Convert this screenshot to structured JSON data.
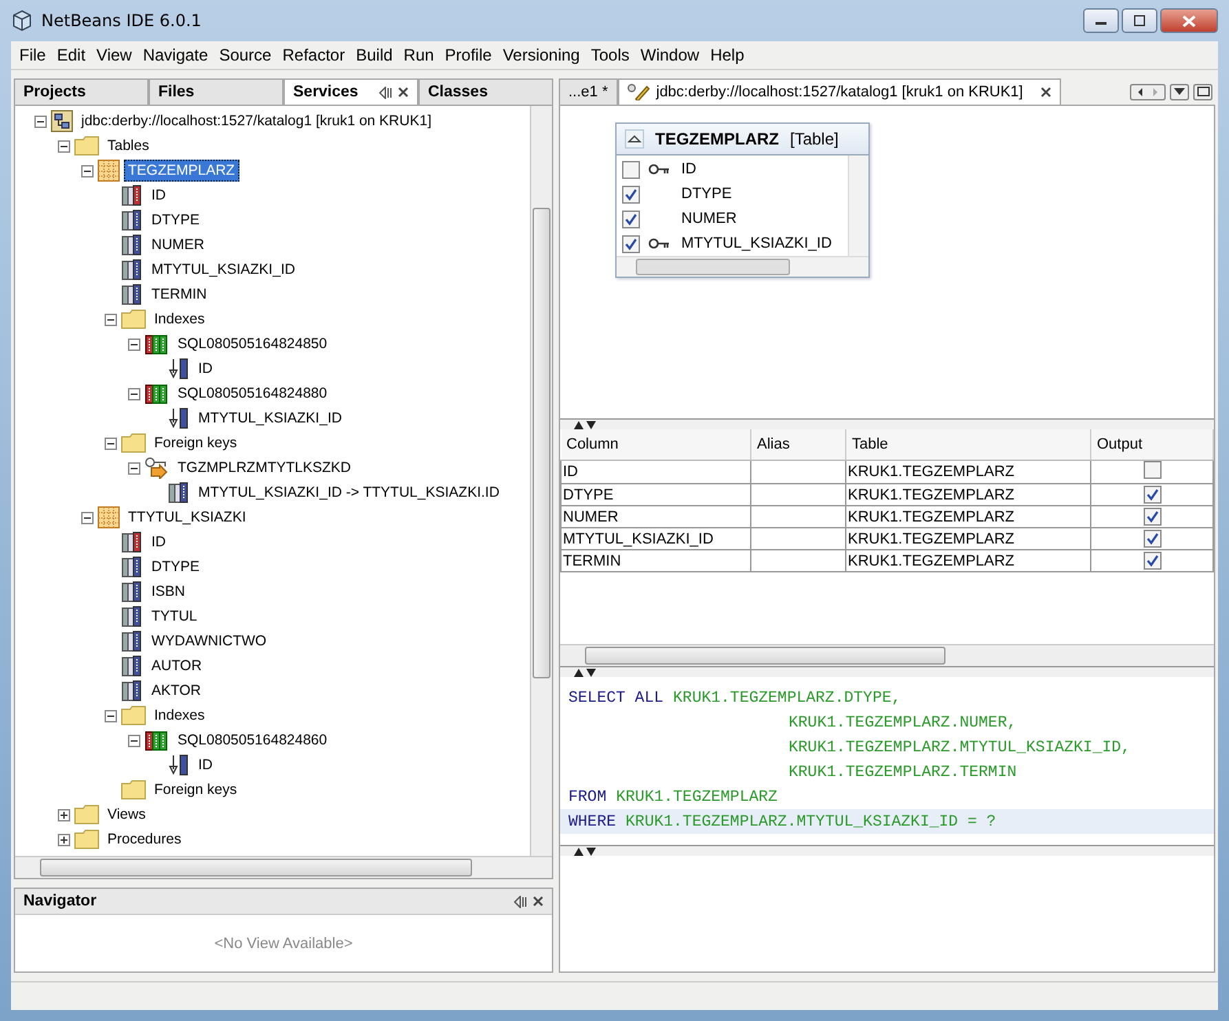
{
  "window": {
    "title": "NetBeans IDE 6.0.1"
  },
  "menu": [
    "File",
    "Edit",
    "View",
    "Navigate",
    "Source",
    "Refactor",
    "Build",
    "Run",
    "Profile",
    "Versioning",
    "Tools",
    "Window",
    "Help"
  ],
  "left_tabs": [
    {
      "label": "Projects",
      "selected": false
    },
    {
      "label": "Files",
      "selected": false
    },
    {
      "label": "Services",
      "selected": true
    },
    {
      "label": "Classes",
      "selected": false
    }
  ],
  "tree": {
    "items": [
      {
        "kind": "connection",
        "label": "jdbc:derby://localhost:1527/katalog1 [kruk1 on KRUK1]",
        "expanded": true,
        "selected": false,
        "children": [
          {
            "kind": "folder",
            "label": "Tables",
            "expanded": true,
            "selected": false,
            "children": [
              {
                "kind": "table",
                "label": "TEGZEMPLARZ",
                "expanded": true,
                "selected": true,
                "children": [
                  {
                    "kind": "pk_column",
                    "label": "ID",
                    "selected": false
                  },
                  {
                    "kind": "column",
                    "label": "DTYPE",
                    "selected": false
                  },
                  {
                    "kind": "column",
                    "label": "NUMER",
                    "selected": false
                  },
                  {
                    "kind": "column",
                    "label": "MTYTUL_KSIAZKI_ID",
                    "selected": false
                  },
                  {
                    "kind": "column",
                    "label": "TERMIN",
                    "selected": false
                  },
                  {
                    "kind": "folder",
                    "label": "Indexes",
                    "expanded": true,
                    "selected": false,
                    "children": [
                      {
                        "kind": "index",
                        "label": "SQL080505164824850",
                        "expanded": true,
                        "selected": false,
                        "children": [
                          {
                            "kind": "index_column",
                            "label": "ID",
                            "selected": false
                          }
                        ]
                      },
                      {
                        "kind": "index",
                        "label": "SQL080505164824880",
                        "expanded": true,
                        "selected": false,
                        "children": [
                          {
                            "kind": "index_column",
                            "label": "MTYTUL_KSIAZKI_ID",
                            "selected": false
                          }
                        ]
                      }
                    ]
                  },
                  {
                    "kind": "folder",
                    "label": "Foreign keys",
                    "expanded": true,
                    "selected": false,
                    "children": [
                      {
                        "kind": "foreign_key",
                        "label": "TGZMPLRZMTYTLKSZKD",
                        "expanded": true,
                        "selected": false,
                        "children": [
                          {
                            "kind": "fk_column",
                            "label": "MTYTUL_KSIAZKI_ID -> TTYTUL_KSIAZKI.ID",
                            "selected": false
                          }
                        ]
                      }
                    ]
                  }
                ]
              },
              {
                "kind": "table",
                "label": "TTYTUL_KSIAZKI",
                "expanded": true,
                "selected": false,
                "children": [
                  {
                    "kind": "pk_column",
                    "label": "ID",
                    "selected": false
                  },
                  {
                    "kind": "column",
                    "label": "DTYPE",
                    "selected": false
                  },
                  {
                    "kind": "column",
                    "label": "ISBN",
                    "selected": false
                  },
                  {
                    "kind": "column",
                    "label": "TYTUL",
                    "selected": false
                  },
                  {
                    "kind": "column",
                    "label": "WYDAWNICTWO",
                    "selected": false
                  },
                  {
                    "kind": "column",
                    "label": "AUTOR",
                    "selected": false
                  },
                  {
                    "kind": "column",
                    "label": "AKTOR",
                    "selected": false
                  },
                  {
                    "kind": "folder",
                    "label": "Indexes",
                    "expanded": true,
                    "selected": false,
                    "children": [
                      {
                        "kind": "index",
                        "label": "SQL080505164824860",
                        "expanded": true,
                        "selected": false,
                        "children": [
                          {
                            "kind": "index_column",
                            "label": "ID",
                            "selected": false
                          }
                        ]
                      }
                    ]
                  },
                  {
                    "kind": "folder",
                    "label": "Foreign keys",
                    "selected": false
                  }
                ]
              }
            ]
          },
          {
            "kind": "folder",
            "label": "Views",
            "expanded": false,
            "selected": false
          },
          {
            "kind": "folder",
            "label": "Procedures",
            "expanded": false,
            "selected": false
          }
        ]
      }
    ]
  },
  "navigator": {
    "title": "Navigator",
    "message": "<No View Available>"
  },
  "editor_tabs": [
    {
      "label": "...e1 *",
      "selected": false
    },
    {
      "label": "jdbc:derby://localhost:1527/katalog1 [kruk1 on KRUK1]",
      "selected": true
    }
  ],
  "diagram": {
    "table_name": "TEGZEMPLARZ",
    "table_type": "[Table]",
    "columns": [
      {
        "kind": "key",
        "name": "ID",
        "checked": false
      },
      {
        "kind": "plain",
        "name": "DTYPE",
        "checked": true
      },
      {
        "kind": "plain",
        "name": "NUMER",
        "checked": true
      },
      {
        "kind": "key",
        "name": "MTYTUL_KSIAZKI_ID",
        "checked": true
      }
    ]
  },
  "grid": {
    "columns": [
      "Column",
      "Alias",
      "Table",
      "Output"
    ],
    "rows": [
      {
        "column": "ID",
        "table": "KRUK1.TEGZEMPLARZ",
        "output": false
      },
      {
        "column": "DTYPE",
        "table": "KRUK1.TEGZEMPLARZ",
        "output": true
      },
      {
        "column": "NUMER",
        "table": "KRUK1.TEGZEMPLARZ",
        "output": true
      },
      {
        "column": "MTYTUL_KSIAZKI_ID",
        "table": "KRUK1.TEGZEMPLARZ",
        "output": true
      },
      {
        "column": "TERMIN",
        "table": "KRUK1.TEGZEMPLARZ",
        "output": true
      }
    ]
  },
  "sql": {
    "lines": [
      {
        "indented": false,
        "current": false,
        "tokens": [
          {
            "kind": "keyword",
            "text": "SELECT ALL"
          },
          {
            "kind": "identifier",
            "text": "KRUK1.TEGZEMPLARZ.DTYPE,"
          }
        ]
      },
      {
        "indented": true,
        "current": false,
        "tokens": [
          {
            "kind": "identifier",
            "text": "KRUK1.TEGZEMPLARZ.NUMER,"
          }
        ]
      },
      {
        "indented": true,
        "current": false,
        "tokens": [
          {
            "kind": "identifier",
            "text": "KRUK1.TEGZEMPLARZ.MTYTUL_KSIAZKI_ID,"
          }
        ]
      },
      {
        "indented": true,
        "current": false,
        "tokens": [
          {
            "kind": "identifier",
            "text": "KRUK1.TEGZEMPLARZ.TERMIN"
          }
        ]
      },
      {
        "indented": false,
        "current": false,
        "tokens": [
          {
            "kind": "keyword",
            "text": "FROM"
          },
          {
            "kind": "identifier",
            "text": "KRUK1.TEGZEMPLARZ"
          }
        ]
      },
      {
        "indented": false,
        "current": true,
        "tokens": [
          {
            "kind": "keyword",
            "text": "WHERE"
          },
          {
            "kind": "identifier",
            "text": "KRUK1.TEGZEMPLARZ.MTYTUL_KSIAZKI_ID = ?"
          }
        ]
      }
    ]
  }
}
